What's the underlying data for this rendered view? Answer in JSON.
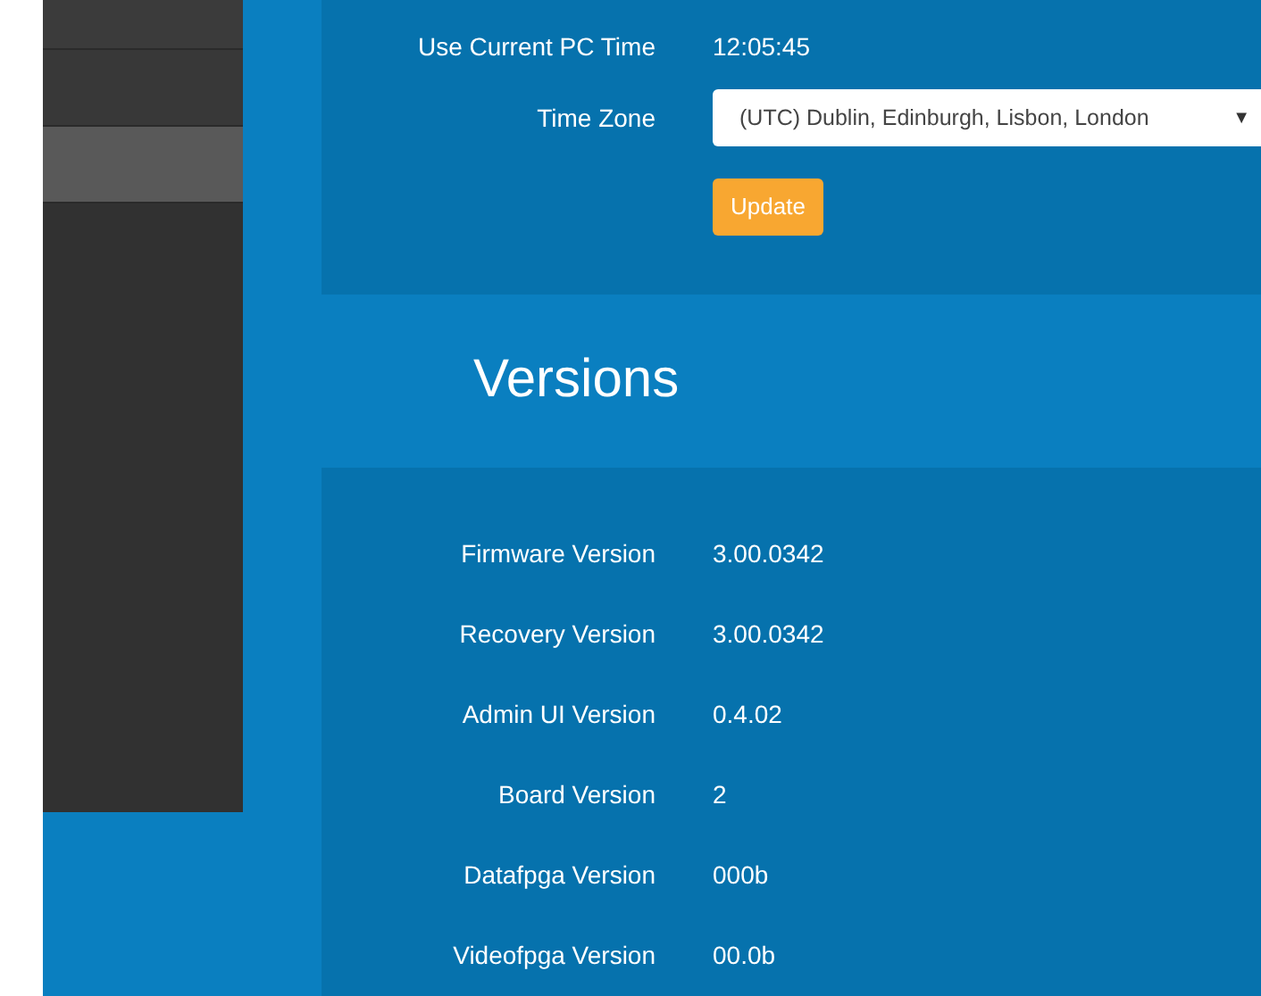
{
  "sidebar": {
    "items": [
      {
        "selected": false
      },
      {
        "selected": false
      },
      {
        "selected": true
      }
    ]
  },
  "time_settings": {
    "fields": [
      {
        "kind": "text",
        "label": "Use Current PC Time",
        "value": "12:05:45"
      },
      {
        "kind": "select",
        "label": "Time Zone",
        "value": "(UTC) Dublin, Edinburgh, Lisbon, London",
        "caret": "▼"
      }
    ],
    "button": "Update"
  },
  "versions": {
    "title": "Versions",
    "rows": [
      {
        "label": "Firmware Version",
        "value": "3.00.0342"
      },
      {
        "label": "Recovery Version",
        "value": "3.00.0342"
      },
      {
        "label": "Admin UI Version",
        "value": "0.4.02"
      },
      {
        "label": "Board Version",
        "value": "2"
      },
      {
        "label": "Datafpga Version",
        "value": "000b"
      },
      {
        "label": "Videofpga Version",
        "value": "00.0b"
      }
    ]
  }
}
